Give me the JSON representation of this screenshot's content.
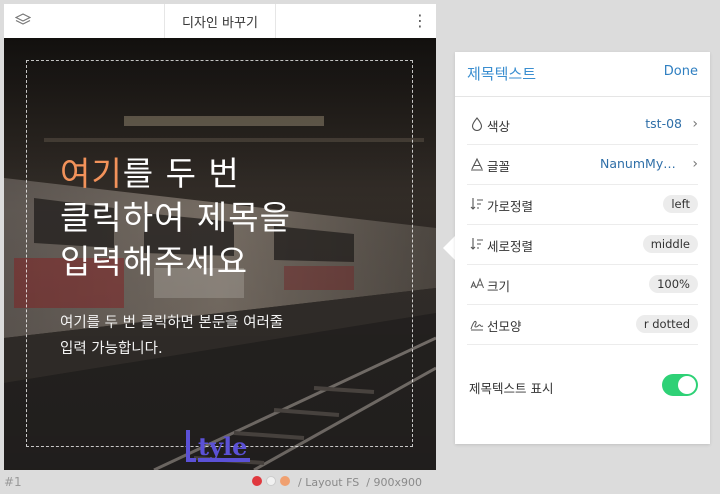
{
  "editor": {
    "title_tab": "디자인 바꾸기",
    "more_symbol": "⋮"
  },
  "canvas": {
    "headline_accent": "여기",
    "headline_line1_rest": "를 두 번",
    "headline_line2": "클릭하여 제목을",
    "headline_line3": "입력해주세요",
    "body_line1": "여기를 두 번 클릭하면 본문을 여러줄",
    "body_line2": "입력 가능합니다.",
    "logo_text": "tyle",
    "accent_color": "#f2925a"
  },
  "footer": {
    "slide_number": "#1",
    "palette": [
      "#e0383e",
      "#f1f1f1",
      "#f0a070"
    ],
    "separator": "/",
    "layout": "Layout FS",
    "size": "900x900"
  },
  "panel": {
    "title": "제목텍스트",
    "done_label": "Done",
    "rows": [
      {
        "icon": "drop-icon",
        "label": "색상",
        "value": "tst-08",
        "type": "link"
      },
      {
        "icon": "font-icon",
        "label": "글꼴",
        "value": "NanumMyeongjo",
        "type": "link"
      },
      {
        "icon": "sort-down-icon",
        "label": "가로정렬",
        "value": "left",
        "type": "pill"
      },
      {
        "icon": "sort-down-icon",
        "label": "세로정렬",
        "value": "middle",
        "type": "pill"
      },
      {
        "icon": "text-size-icon",
        "label": "크기",
        "value": "100%",
        "type": "pill"
      },
      {
        "icon": "signature-icon",
        "label": "선모양",
        "value": "r dotted",
        "type": "pill"
      }
    ],
    "toggle_label": "제목텍스트 표시",
    "toggle_on": true,
    "accent": "#3a8ed0",
    "switch_color": "#2ed176"
  }
}
